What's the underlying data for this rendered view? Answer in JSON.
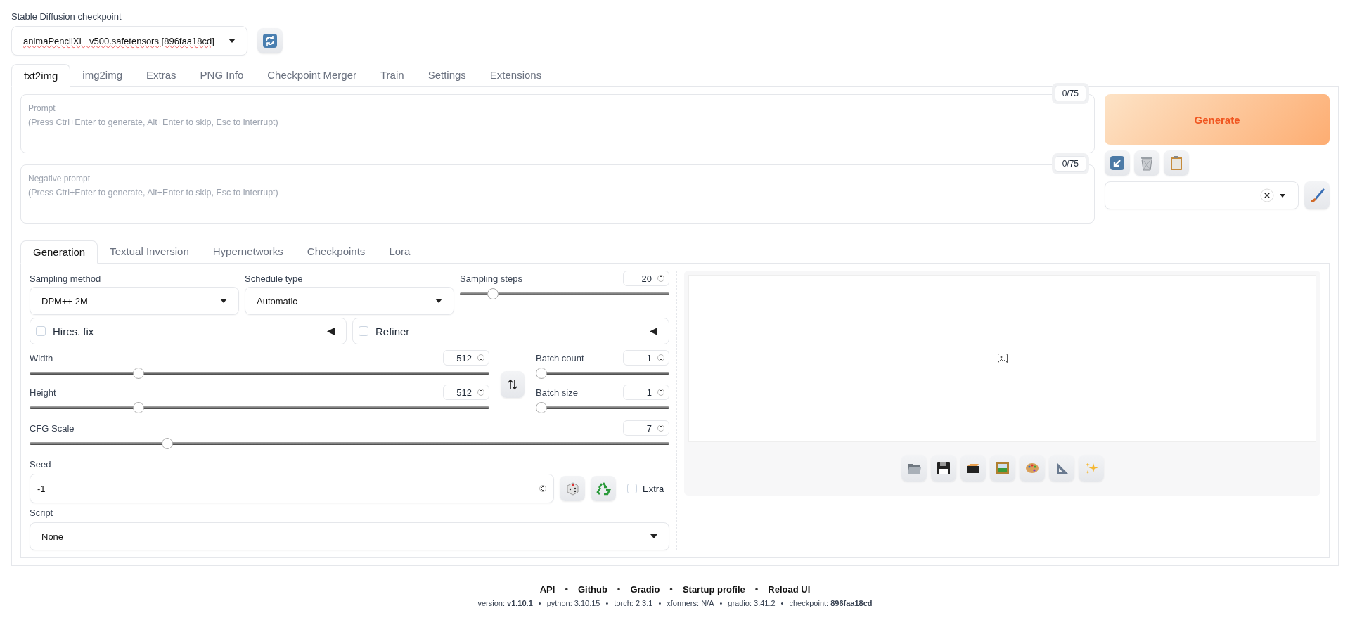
{
  "checkpoint": {
    "label": "Stable Diffusion checkpoint",
    "value": "animaPencilXL_v500.safetensors [896faa18cd]"
  },
  "tabs": [
    {
      "label": "txt2img",
      "selected": true
    },
    {
      "label": "img2img",
      "selected": false
    },
    {
      "label": "Extras",
      "selected": false
    },
    {
      "label": "PNG Info",
      "selected": false
    },
    {
      "label": "Checkpoint Merger",
      "selected": false
    },
    {
      "label": "Train",
      "selected": false
    },
    {
      "label": "Settings",
      "selected": false
    },
    {
      "label": "Extensions",
      "selected": false
    }
  ],
  "prompts": [
    {
      "label": "Prompt",
      "placeholder": "(Press Ctrl+Enter to generate, Alt+Enter to skip, Esc to interrupt)",
      "counter": "0/75"
    },
    {
      "label": "Negative prompt",
      "placeholder": "(Press Ctrl+Enter to generate, Alt+Enter to skip, Esc to interrupt)",
      "counter": "0/75"
    }
  ],
  "generate": "Generate",
  "subtabs": [
    {
      "label": "Generation",
      "selected": true
    },
    {
      "label": "Textual Inversion",
      "selected": false
    },
    {
      "label": "Hypernetworks",
      "selected": false
    },
    {
      "label": "Checkpoints",
      "selected": false
    },
    {
      "label": "Lora",
      "selected": false
    }
  ],
  "sampling_method": {
    "label": "Sampling method",
    "value": "DPM++ 2M"
  },
  "schedule_type": {
    "label": "Schedule type",
    "value": "Automatic"
  },
  "steps": {
    "label": "Sampling steps",
    "value": "20",
    "level": 0.14
  },
  "accordions": [
    {
      "label": "Hires. fix",
      "checked": false
    },
    {
      "label": "Refiner",
      "checked": false
    }
  ],
  "size_sliders": [
    {
      "label": "Width",
      "value": "512",
      "level": 0.23
    },
    {
      "label": "Height",
      "value": "512",
      "level": 0.23
    }
  ],
  "batch_sliders": [
    {
      "label": "Batch count",
      "value": "1",
      "level": 0
    },
    {
      "label": "Batch size",
      "value": "1",
      "level": 0
    }
  ],
  "cfg": {
    "label": "CFG Scale",
    "value": "7",
    "level": 0.21
  },
  "seed": {
    "label": "Seed",
    "value": "-1"
  },
  "extra": {
    "label": "Extra",
    "checked": false
  },
  "script": {
    "label": "Script",
    "value": "None"
  },
  "footer": {
    "links": [
      {
        "kind": "link",
        "text": "API"
      },
      {
        "kind": "separator",
        "text": "•"
      },
      {
        "kind": "link",
        "text": "Github"
      },
      {
        "kind": "separator",
        "text": "•"
      },
      {
        "kind": "link",
        "text": "Gradio"
      },
      {
        "kind": "separator",
        "text": "•"
      },
      {
        "kind": "link",
        "text": "Startup profile"
      },
      {
        "kind": "separator",
        "text": "•"
      },
      {
        "kind": "link",
        "text": "Reload UI"
      }
    ],
    "info": [
      {
        "kind": "text",
        "text": "version: **v1.10.1**"
      },
      {
        "kind": "separator",
        "text": "•"
      },
      {
        "kind": "text",
        "text": "python: 3.10.15"
      },
      {
        "kind": "separator",
        "text": "•"
      },
      {
        "kind": "text",
        "text": "torch: 2.3.1"
      },
      {
        "kind": "separator",
        "text": "•"
      },
      {
        "kind": "text",
        "text": "xformers: N/A"
      },
      {
        "kind": "separator",
        "text": "•"
      },
      {
        "kind": "text",
        "text": "gradio: 3.41.2"
      },
      {
        "kind": "separator",
        "text": "•"
      },
      {
        "kind": "text",
        "text": "checkpoint: **896faa18cd**"
      }
    ]
  }
}
